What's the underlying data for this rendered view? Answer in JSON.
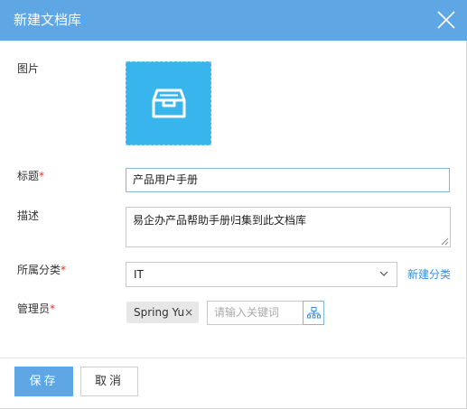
{
  "dialog": {
    "title": "新建文档库",
    "close_icon": "close-icon"
  },
  "form": {
    "image": {
      "label": "图片",
      "icon": "inbox-tray-icon",
      "color": "#38b5ec"
    },
    "title": {
      "label": "标题",
      "required_mark": "*",
      "value": "产品用户手册"
    },
    "description": {
      "label": "描述",
      "value": "易企办产品帮助手册归集到此文档库"
    },
    "category": {
      "label": "所属分类",
      "required_mark": "*",
      "selected": "IT",
      "new_category_link": "新建分类"
    },
    "admin": {
      "label": "管理员",
      "required_mark": "*",
      "tags": [
        {
          "name": "Spring Yu",
          "remove": "×"
        }
      ],
      "keyword_placeholder": "请输入关键词",
      "org_icon": "org-chart-icon"
    }
  },
  "footer": {
    "save_label": "保存",
    "cancel_label": "取消"
  },
  "colors": {
    "header": "#5ea6e4",
    "primary_button": "#5ea6e4",
    "link": "#3c8fd8",
    "required": "#e0322b"
  }
}
